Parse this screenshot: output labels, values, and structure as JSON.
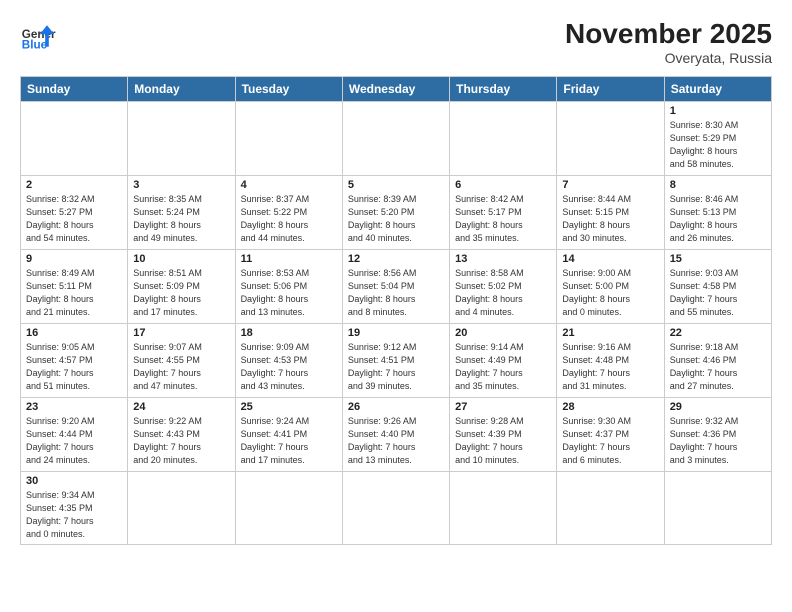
{
  "header": {
    "logo_general": "General",
    "logo_blue": "Blue",
    "title": "November 2025",
    "subtitle": "Overyata, Russia"
  },
  "days_of_week": [
    "Sunday",
    "Monday",
    "Tuesday",
    "Wednesday",
    "Thursday",
    "Friday",
    "Saturday"
  ],
  "weeks": [
    [
      {
        "day": "",
        "info": ""
      },
      {
        "day": "",
        "info": ""
      },
      {
        "day": "",
        "info": ""
      },
      {
        "day": "",
        "info": ""
      },
      {
        "day": "",
        "info": ""
      },
      {
        "day": "",
        "info": ""
      },
      {
        "day": "1",
        "info": "Sunrise: 8:30 AM\nSunset: 5:29 PM\nDaylight: 8 hours\nand 58 minutes."
      }
    ],
    [
      {
        "day": "2",
        "info": "Sunrise: 8:32 AM\nSunset: 5:27 PM\nDaylight: 8 hours\nand 54 minutes."
      },
      {
        "day": "3",
        "info": "Sunrise: 8:35 AM\nSunset: 5:24 PM\nDaylight: 8 hours\nand 49 minutes."
      },
      {
        "day": "4",
        "info": "Sunrise: 8:37 AM\nSunset: 5:22 PM\nDaylight: 8 hours\nand 44 minutes."
      },
      {
        "day": "5",
        "info": "Sunrise: 8:39 AM\nSunset: 5:20 PM\nDaylight: 8 hours\nand 40 minutes."
      },
      {
        "day": "6",
        "info": "Sunrise: 8:42 AM\nSunset: 5:17 PM\nDaylight: 8 hours\nand 35 minutes."
      },
      {
        "day": "7",
        "info": "Sunrise: 8:44 AM\nSunset: 5:15 PM\nDaylight: 8 hours\nand 30 minutes."
      },
      {
        "day": "8",
        "info": "Sunrise: 8:46 AM\nSunset: 5:13 PM\nDaylight: 8 hours\nand 26 minutes."
      }
    ],
    [
      {
        "day": "9",
        "info": "Sunrise: 8:49 AM\nSunset: 5:11 PM\nDaylight: 8 hours\nand 21 minutes."
      },
      {
        "day": "10",
        "info": "Sunrise: 8:51 AM\nSunset: 5:09 PM\nDaylight: 8 hours\nand 17 minutes."
      },
      {
        "day": "11",
        "info": "Sunrise: 8:53 AM\nSunset: 5:06 PM\nDaylight: 8 hours\nand 13 minutes."
      },
      {
        "day": "12",
        "info": "Sunrise: 8:56 AM\nSunset: 5:04 PM\nDaylight: 8 hours\nand 8 minutes."
      },
      {
        "day": "13",
        "info": "Sunrise: 8:58 AM\nSunset: 5:02 PM\nDaylight: 8 hours\nand 4 minutes."
      },
      {
        "day": "14",
        "info": "Sunrise: 9:00 AM\nSunset: 5:00 PM\nDaylight: 8 hours\nand 0 minutes."
      },
      {
        "day": "15",
        "info": "Sunrise: 9:03 AM\nSunset: 4:58 PM\nDaylight: 7 hours\nand 55 minutes."
      }
    ],
    [
      {
        "day": "16",
        "info": "Sunrise: 9:05 AM\nSunset: 4:57 PM\nDaylight: 7 hours\nand 51 minutes."
      },
      {
        "day": "17",
        "info": "Sunrise: 9:07 AM\nSunset: 4:55 PM\nDaylight: 7 hours\nand 47 minutes."
      },
      {
        "day": "18",
        "info": "Sunrise: 9:09 AM\nSunset: 4:53 PM\nDaylight: 7 hours\nand 43 minutes."
      },
      {
        "day": "19",
        "info": "Sunrise: 9:12 AM\nSunset: 4:51 PM\nDaylight: 7 hours\nand 39 minutes."
      },
      {
        "day": "20",
        "info": "Sunrise: 9:14 AM\nSunset: 4:49 PM\nDaylight: 7 hours\nand 35 minutes."
      },
      {
        "day": "21",
        "info": "Sunrise: 9:16 AM\nSunset: 4:48 PM\nDaylight: 7 hours\nand 31 minutes."
      },
      {
        "day": "22",
        "info": "Sunrise: 9:18 AM\nSunset: 4:46 PM\nDaylight: 7 hours\nand 27 minutes."
      }
    ],
    [
      {
        "day": "23",
        "info": "Sunrise: 9:20 AM\nSunset: 4:44 PM\nDaylight: 7 hours\nand 24 minutes."
      },
      {
        "day": "24",
        "info": "Sunrise: 9:22 AM\nSunset: 4:43 PM\nDaylight: 7 hours\nand 20 minutes."
      },
      {
        "day": "25",
        "info": "Sunrise: 9:24 AM\nSunset: 4:41 PM\nDaylight: 7 hours\nand 17 minutes."
      },
      {
        "day": "26",
        "info": "Sunrise: 9:26 AM\nSunset: 4:40 PM\nDaylight: 7 hours\nand 13 minutes."
      },
      {
        "day": "27",
        "info": "Sunrise: 9:28 AM\nSunset: 4:39 PM\nDaylight: 7 hours\nand 10 minutes."
      },
      {
        "day": "28",
        "info": "Sunrise: 9:30 AM\nSunset: 4:37 PM\nDaylight: 7 hours\nand 6 minutes."
      },
      {
        "day": "29",
        "info": "Sunrise: 9:32 AM\nSunset: 4:36 PM\nDaylight: 7 hours\nand 3 minutes."
      }
    ],
    [
      {
        "day": "30",
        "info": "Sunrise: 9:34 AM\nSunset: 4:35 PM\nDaylight: 7 hours\nand 0 minutes."
      },
      {
        "day": "",
        "info": ""
      },
      {
        "day": "",
        "info": ""
      },
      {
        "day": "",
        "info": ""
      },
      {
        "day": "",
        "info": ""
      },
      {
        "day": "",
        "info": ""
      },
      {
        "day": "",
        "info": ""
      }
    ]
  ]
}
